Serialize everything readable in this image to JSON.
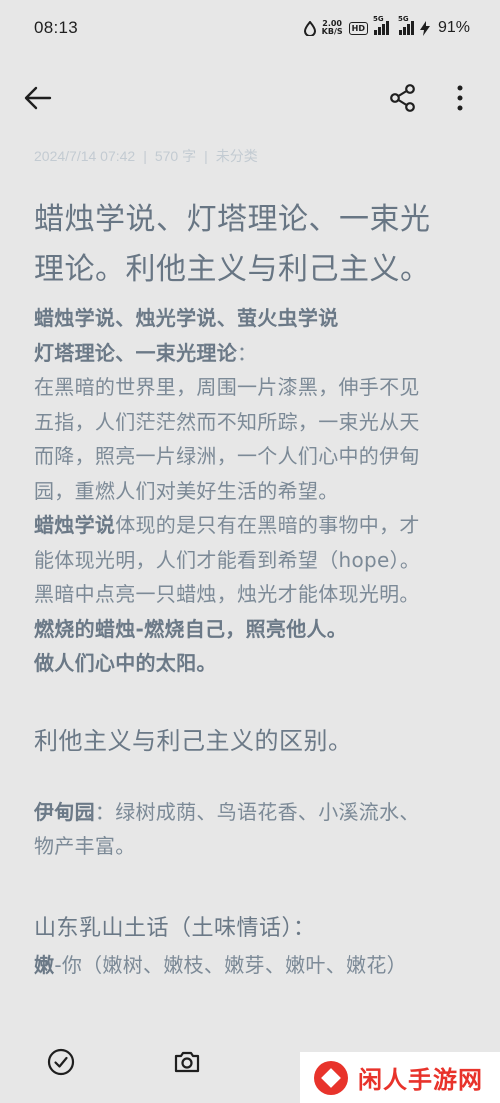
{
  "status_bar": {
    "time": "08:13",
    "speed_value": "2.00",
    "speed_unit": "KB/S",
    "hd_label": "HD",
    "signal1_label": "5G",
    "signal2_label": "5G",
    "battery_percent": "91%"
  },
  "toolbar": {
    "back_icon": "arrow-left-icon",
    "share_icon": "share-icon",
    "more_icon": "more-vertical-icon"
  },
  "note": {
    "date": "2024/7/14 07:42",
    "word_count": "570 字",
    "category": "未分类",
    "title_lines": [
      "蜡烛学说、灯塔理论、一束光",
      "理论。利他主义与利己主义。"
    ],
    "heading1": "蜡烛学说、烛光学说、萤火虫学说",
    "heading2": "灯塔理论、一束光理论",
    "heading2_suffix": "：",
    "para1_lines": [
      "在黑暗的世界里，周围一片漆黑，伸手不见",
      "五指，人们茫茫然而不知所踪，一束光从天",
      "而降，照亮一片绿洲，一个人们心中的伊甸",
      "园，重燃人们对美好生活的希望。"
    ],
    "para2_bold": "蜡烛学说",
    "para2_rest_first": "体现的是只有在黑暗的事物中，才",
    "para2_lines": [
      "能体现光明，人们才能看到希望（hope）。",
      "黑暗中点亮一只蜡烛，烛光才能体现光明。"
    ],
    "bold_line1": "燃烧的蜡烛-燃烧自己，照亮他人。",
    "bold_line2": "做人们心中的太阳。",
    "subhead": "利他主义与利己主义的区别。",
    "eden_label": "伊甸园",
    "eden_rest_first": "：绿树成荫、鸟语花香、小溪流水、",
    "eden_second": "物产丰富。",
    "dialect_heading": "山东乳山土话（土味情话）：",
    "nen_bold": "嫩",
    "nen_rest": "-你（嫩树、嫩枝、嫩芽、嫩叶、嫩花）"
  },
  "bottom_bar": {
    "check_icon": "check-circle-icon",
    "camera_icon": "camera-icon"
  },
  "watermark": {
    "text": "闲人手游网"
  }
}
